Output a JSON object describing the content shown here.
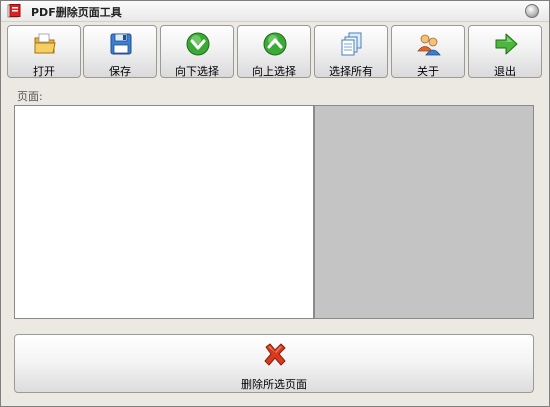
{
  "window": {
    "title": "PDF删除页面工具"
  },
  "toolbar": {
    "buttons": [
      {
        "label": "打开",
        "icon": "folder-icon"
      },
      {
        "label": "保存",
        "icon": "floppy-disk-icon"
      },
      {
        "label": "向下选择",
        "icon": "arrow-down-circle-icon"
      },
      {
        "label": "向上选择",
        "icon": "arrow-up-circle-icon"
      },
      {
        "label": "选择所有",
        "icon": "documents-icon"
      },
      {
        "label": "关于",
        "icon": "users-icon"
      },
      {
        "label": "退出",
        "icon": "arrow-right-icon"
      }
    ]
  },
  "main": {
    "pages_label": "页面:"
  },
  "footer": {
    "delete_label": "删除所选页面",
    "delete_icon": "red-x-icon"
  },
  "colors": {
    "window_bg": "#ece9e3",
    "preview_bg": "#c4c4c4",
    "accent_green": "#3aa935",
    "delete_red": "#d83a1f"
  }
}
